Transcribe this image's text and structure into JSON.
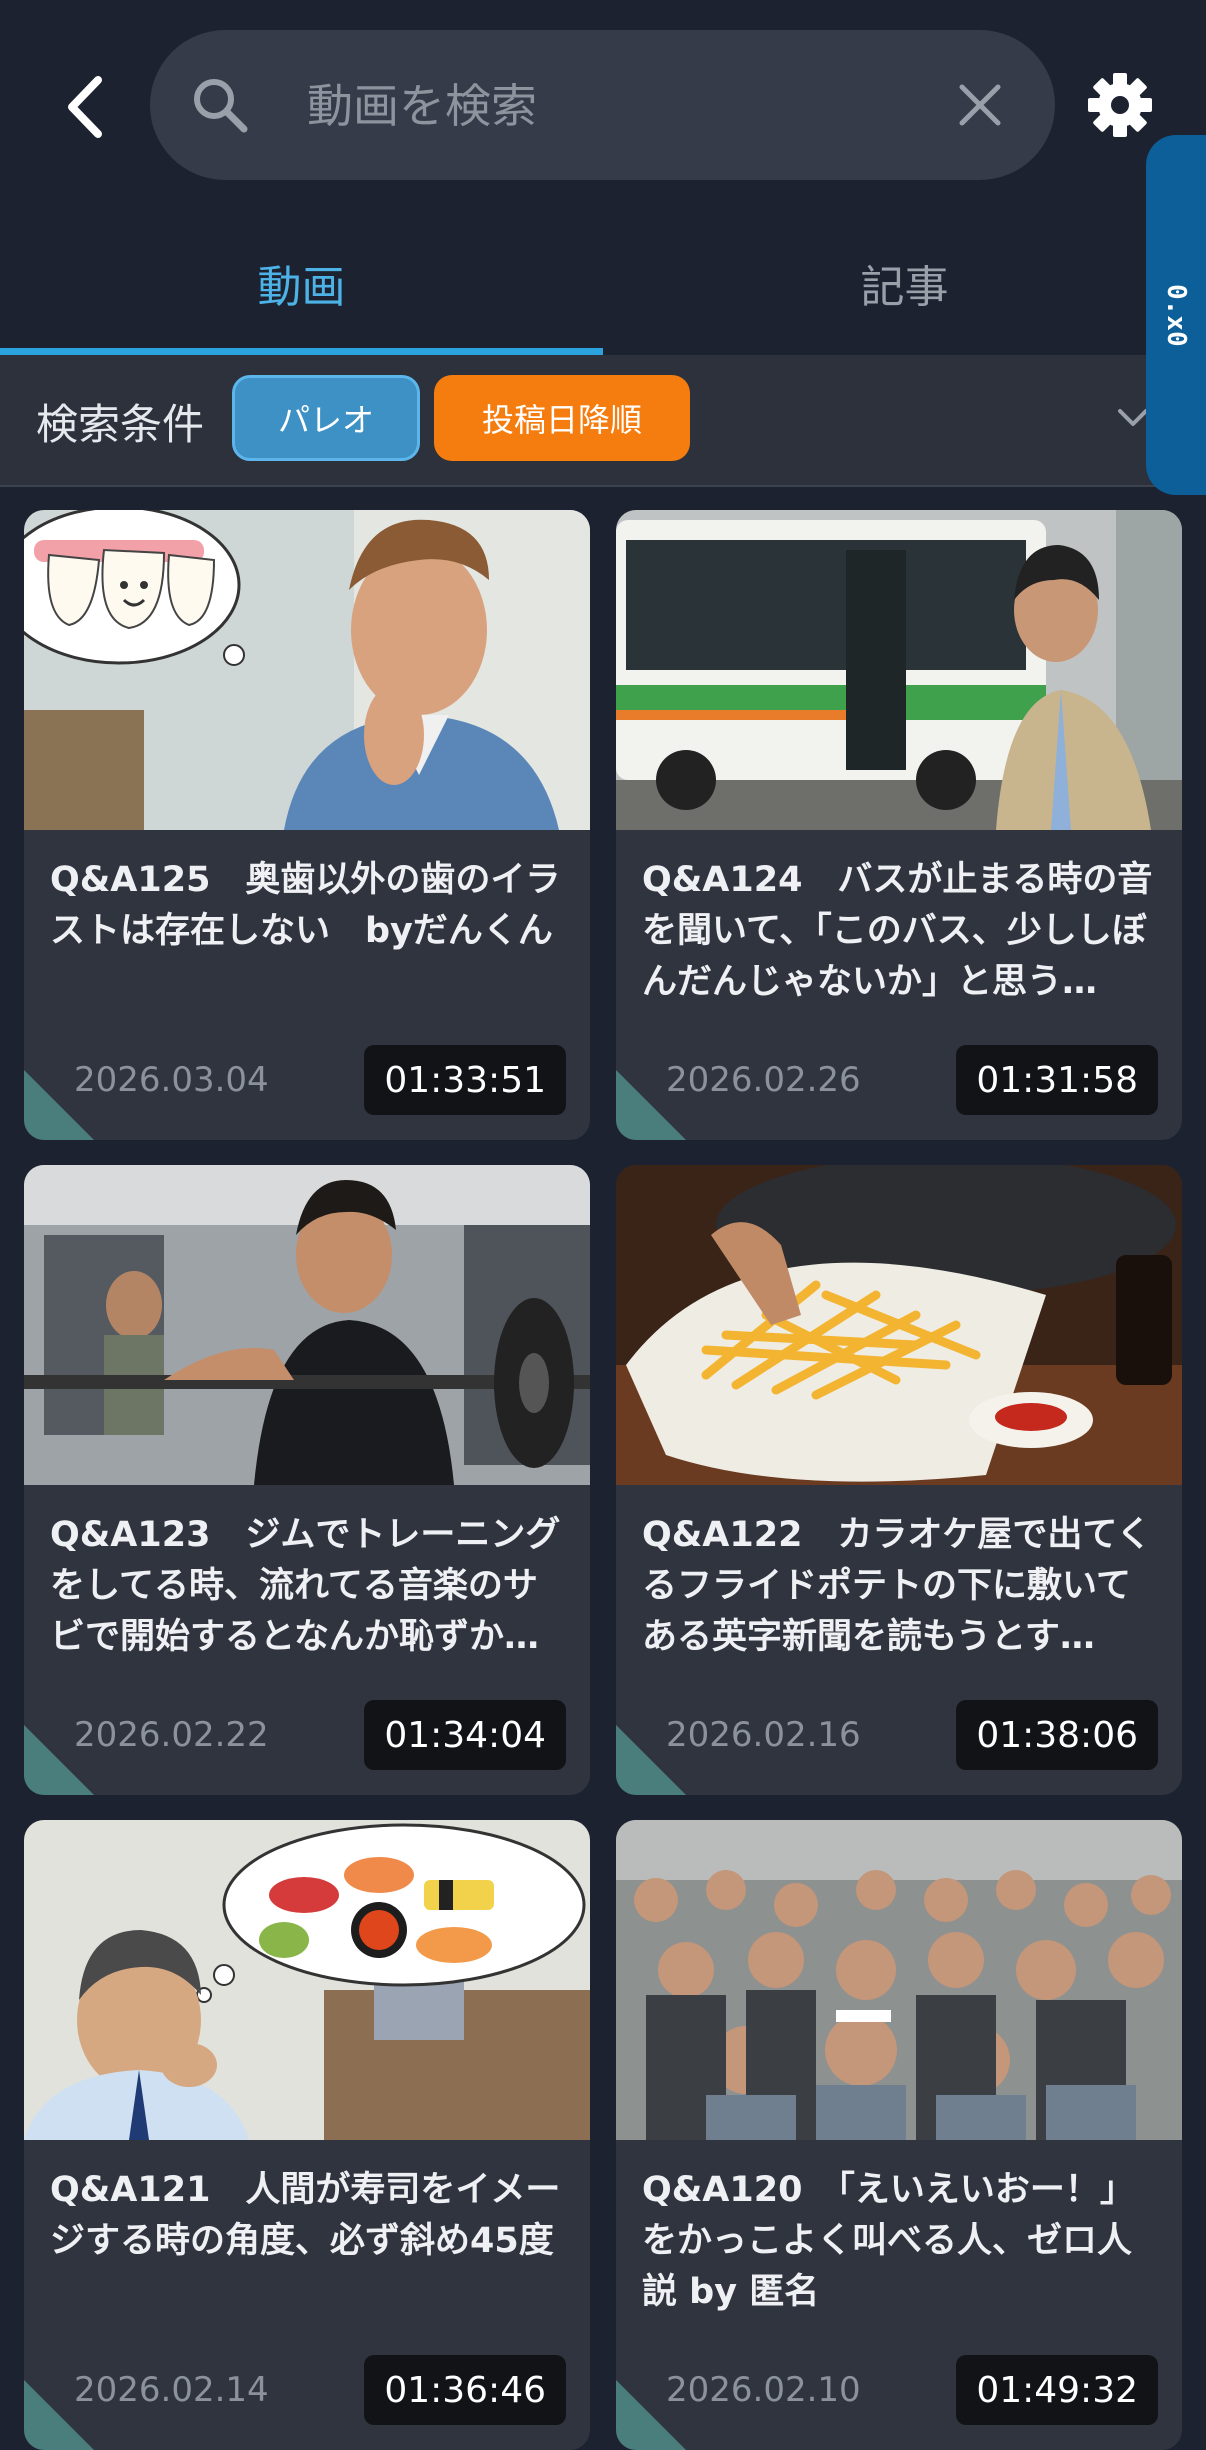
{
  "header": {
    "search_placeholder": "動画を検索",
    "side_tab_label": "0.x0"
  },
  "tabs": [
    {
      "label": "動画",
      "active": true
    },
    {
      "label": "記事",
      "active": false
    }
  ],
  "filters": {
    "label": "検索条件",
    "chips": [
      {
        "label": "パレオ",
        "color": "#3d91c4"
      },
      {
        "label": "投稿日降順",
        "color": "#f57c0f"
      }
    ]
  },
  "videos": [
    {
      "title": "Q&A125　奥歯以外の歯のイラストは存在しない　byだんくん",
      "date": "2026.03.04",
      "duration": "01:33:51"
    },
    {
      "title": "Q&A124　バスが止まる時の音を聞いて、「このバス、少ししぼんだんじゃないか」と思う…",
      "date": "2026.02.26",
      "duration": "01:31:58"
    },
    {
      "title": "Q&A123　ジムでトレーニングをしてる時、流れてる音楽のサビで開始するとなんか恥ずか…",
      "date": "2026.02.22",
      "duration": "01:34:04"
    },
    {
      "title": "Q&A122　カラオケ屋で出てくるフライドポテトの下に敷いてある英字新聞を読もうとす…",
      "date": "2026.02.16",
      "duration": "01:38:06"
    },
    {
      "title": "Q&A121　人間が寿司をイメージする時の角度、必ず斜め45度",
      "date": "2026.02.14",
      "duration": "01:36:46"
    },
    {
      "title": "Q&A120　「えいえいおー！」をかっこよく叫べる人、ゼロ人説 by 匿名",
      "date": "2026.02.10",
      "duration": "01:49:32"
    }
  ],
  "colors": {
    "background": "#1c2230",
    "accent": "#2ba3de",
    "card": "#30343e",
    "sort_chip": "#f57c0f"
  }
}
